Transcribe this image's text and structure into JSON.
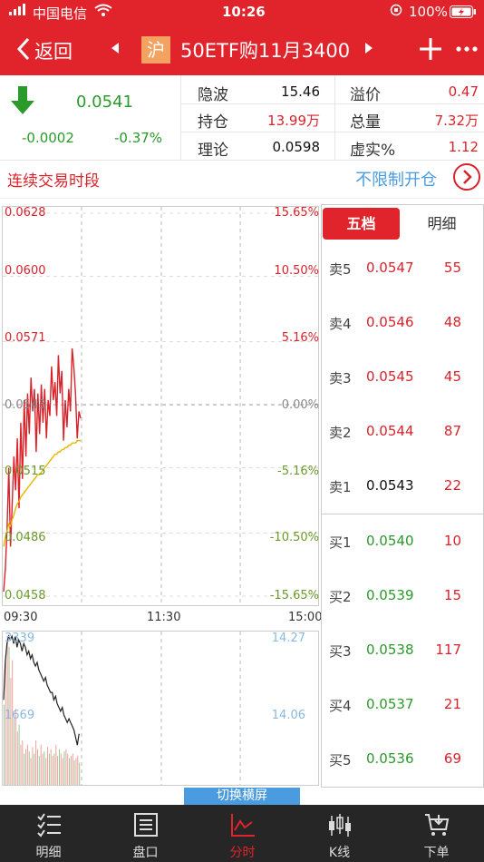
{
  "status_bar": {
    "carrier": "中国电信",
    "time": "10:26",
    "battery": "100%"
  },
  "nav": {
    "back_label": "返回",
    "exchange_badge": "沪",
    "title": "50ETF购11月3400"
  },
  "quote": {
    "price": "0.0541",
    "change": "-0.0002",
    "change_pct": "-0.37%",
    "direction": "down"
  },
  "stats": {
    "iv_label": "隐波",
    "iv_value": "15.46",
    "premium_label": "溢价",
    "premium_value": "0.47",
    "oi_label": "持仓",
    "oi_value": "13.99万",
    "volume_label": "总量",
    "volume_value": "7.32万",
    "theory_label": "理论",
    "theory_value": "0.0598",
    "moneyness_label": "虚实%",
    "moneyness_value": "1.12"
  },
  "session": {
    "label": "连续交易时段",
    "open_limit_label": "不限制开仓"
  },
  "chart_data": {
    "type": "line",
    "y_left_ticks": [
      "0.0628",
      "0.0600",
      "0.0571",
      "0.0543",
      "0.0515",
      "0.0486",
      "0.0458"
    ],
    "y_right_ticks": [
      "15.65%",
      "10.50%",
      "5.16%",
      "0.00%",
      "-5.16%",
      "-10.50%",
      "-15.65%"
    ],
    "x_ticks": [
      "09:30",
      "11:30",
      "15:00"
    ],
    "ylim": [
      0.0458,
      0.0628
    ],
    "series": [
      {
        "color": "#d8232a",
        "values": [
          0.046,
          0.047,
          0.0488,
          0.0515,
          0.048,
          0.0498,
          0.052,
          0.0505,
          0.0528,
          0.0497,
          0.0535,
          0.051,
          0.0545,
          0.052,
          0.0548,
          0.053,
          0.0555,
          0.054,
          0.055,
          0.0522,
          0.0548,
          0.053,
          0.0552,
          0.0535,
          0.055,
          0.0528,
          0.0545,
          0.0538,
          0.056,
          0.0545,
          0.0553,
          0.0538,
          0.0565,
          0.0548,
          0.0558,
          0.0527,
          0.0545,
          0.0533,
          0.055,
          0.054,
          0.0568,
          0.056,
          0.0548,
          0.0528,
          0.054,
          0.0537
        ]
      },
      {
        "color": "#e8b400",
        "values": [
          0.048,
          0.0484,
          0.0487,
          0.049,
          0.0489,
          0.0492,
          0.0494,
          0.0497,
          0.0499,
          0.05,
          0.0502,
          0.0503,
          0.0504,
          0.0505,
          0.0506,
          0.0507,
          0.0508,
          0.0509,
          0.051,
          0.0511,
          0.0512,
          0.0512,
          0.0513,
          0.0514,
          0.0515,
          0.0516,
          0.0517,
          0.0518,
          0.0519,
          0.052,
          0.0521,
          0.0521,
          0.0522,
          0.0522,
          0.0523,
          0.0523,
          0.0524,
          0.0524,
          0.0525,
          0.0525,
          0.0526,
          0.0526,
          0.0526,
          0.0527,
          0.0527,
          0.0527
        ]
      }
    ],
    "volume_panel": {
      "left_ticks": [
        "3339",
        "1669"
      ],
      "right_ticks": [
        "14.27",
        "14.06"
      ],
      "bars": [
        1800,
        2900,
        3339,
        3100,
        2400,
        2800,
        1500,
        1700,
        1200,
        1350,
        900,
        1000,
        700,
        800,
        900,
        750,
        600,
        850,
        700,
        1000,
        800,
        650,
        900,
        700,
        750,
        600,
        850,
        700,
        800,
        650,
        700,
        900,
        650,
        800,
        700,
        600,
        750,
        800,
        700,
        600,
        650,
        700,
        550,
        600,
        650,
        500
      ],
      "line": [
        14.1,
        14.2,
        14.25,
        14.27,
        14.26,
        14.27,
        14.25,
        14.27,
        14.24,
        14.26,
        14.25,
        14.23,
        14.25,
        14.24,
        14.22,
        14.23,
        14.21,
        14.22,
        14.2,
        14.19,
        14.2,
        14.18,
        14.17,
        14.16,
        14.15,
        14.16,
        14.14,
        14.13,
        14.12,
        14.12,
        14.1,
        14.11,
        14.09,
        14.08,
        14.07,
        14.08,
        14.06,
        14.05,
        14.04,
        14.05,
        14.04,
        14.03,
        14.02,
        14.0,
        13.98,
        14.01
      ]
    }
  },
  "order_book": {
    "tab_active": "五档",
    "tab_inactive": "明细",
    "asks": [
      {
        "label": "卖5",
        "price": "0.0547",
        "volume": "55"
      },
      {
        "label": "卖4",
        "price": "0.0546",
        "volume": "48"
      },
      {
        "label": "卖3",
        "price": "0.0545",
        "volume": "45"
      },
      {
        "label": "卖2",
        "price": "0.0544",
        "volume": "87"
      },
      {
        "label": "卖1",
        "price": "0.0543",
        "volume": "22"
      }
    ],
    "bids": [
      {
        "label": "买1",
        "price": "0.0540",
        "volume": "10"
      },
      {
        "label": "买2",
        "price": "0.0539",
        "volume": "15"
      },
      {
        "label": "买3",
        "price": "0.0538",
        "volume": "117"
      },
      {
        "label": "买4",
        "price": "0.0537",
        "volume": "21"
      },
      {
        "label": "买5",
        "price": "0.0536",
        "volume": "69"
      }
    ]
  },
  "landscape_button": "切换横屏",
  "tabbar": [
    {
      "label": "明细",
      "icon": "list-icon"
    },
    {
      "label": "盘口",
      "icon": "book-icon"
    },
    {
      "label": "分时",
      "icon": "intraday-chart-icon",
      "active": true
    },
    {
      "label": "K线",
      "icon": "candlestick-icon"
    },
    {
      "label": "下单",
      "icon": "cart-icon"
    }
  ],
  "colors": {
    "up": "#d8232a",
    "down": "#2a9a2a",
    "brand": "#e1232b",
    "accent_blue": "#4a9be0"
  }
}
